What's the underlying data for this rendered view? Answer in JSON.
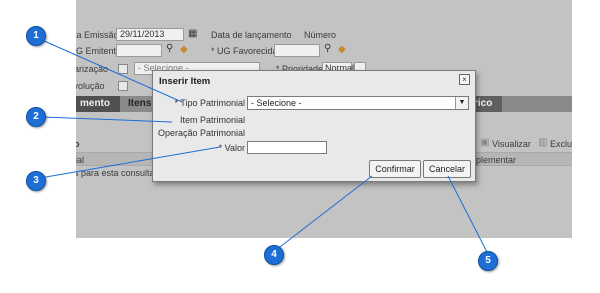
{
  "background": {
    "data_emissao_label": "ta Emissão",
    "data_emissao_value": "29/11/2013",
    "data_lancamento_label": "Data de lançamento",
    "numero_label": "Número",
    "top_right_text": "...",
    "ug_emitente_label": "G Emitente",
    "ug_favorecida_label": "* UG Favorecida",
    "regularizacao_label": "gularização",
    "selecione_partial": "- Selecione -",
    "prioridade_label": "* Prioridade",
    "prioridade_value": "Normal",
    "devolucao_label": "Devolução",
    "tab1": "mento",
    "tab2": "Itens",
    "tab3": "rico",
    "col_header": "o",
    "visualizar": "Visualizar",
    "excluir": "Exclu",
    "row_text": "nial",
    "row_text2": "plementar",
    "empty_msg": "s para esta consulta"
  },
  "dialog": {
    "title": "Inserir Item",
    "close_glyph": "×",
    "tipo_patrimonial_label": "Tipo Patrimonial",
    "tipo_patrimonial_value": "- Selecione -",
    "item_patrimonial_label": "Item Patrimonial",
    "operacao_patrimonial_label": "Operação Patrimonial",
    "valor_label": "Valor",
    "valor_value": "",
    "confirm_label": "Confirmar",
    "cancel_label": "Cancelar"
  },
  "callouts": [
    "1",
    "2",
    "3",
    "4",
    "5"
  ],
  "colors": {
    "callout": "#1d6fd6",
    "overlay": "#c3c3c3",
    "dialog": "#e9e9e9"
  }
}
